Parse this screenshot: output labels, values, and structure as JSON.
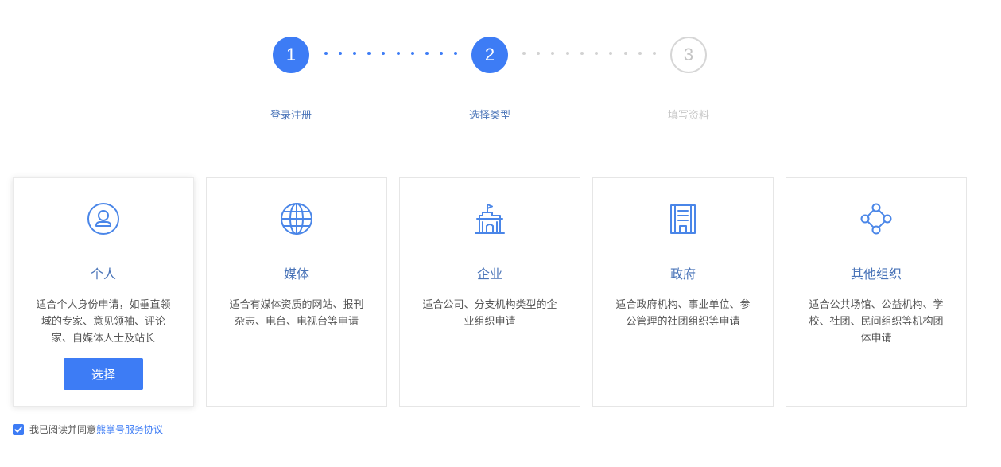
{
  "stepper": {
    "steps": [
      {
        "number": "1",
        "label": "登录注册",
        "state": "done"
      },
      {
        "number": "2",
        "label": "选择类型",
        "state": "current"
      },
      {
        "number": "3",
        "label": "填写资料",
        "state": "todo"
      }
    ],
    "colors": {
      "active": "#3d7cf5",
      "inactive": "#d2d2d2"
    }
  },
  "cards": [
    {
      "icon": "person-circle-icon",
      "title": "个人",
      "desc": "适合个人身份申请，如垂直领域的专家、意见领袖、评论家、自媒体人士及站长",
      "selected": true
    },
    {
      "icon": "globe-icon",
      "title": "媒体",
      "desc": "适合有媒体资质的网站、报刊杂志、电台、电视台等申请",
      "selected": false
    },
    {
      "icon": "building-flag-icon",
      "title": "企业",
      "desc": "适合公司、分支机构类型的企业组织申请",
      "selected": false
    },
    {
      "icon": "office-building-icon",
      "title": "政府",
      "desc": "适合政府机构、事业单位、参公管理的社团组织等申请",
      "selected": false
    },
    {
      "icon": "network-nodes-icon",
      "title": "其他组织",
      "desc": "适合公共场馆、公益机构、学校、社团、民间组织等机构团体申请",
      "selected": false
    }
  ],
  "select_button": {
    "label": "选择"
  },
  "agreement": {
    "checked": true,
    "text": "我已阅读并同意",
    "link_text": "熊掌号服务协议"
  },
  "theme": {
    "accent": "#3d7cf5",
    "title_color": "#4a74b8"
  }
}
